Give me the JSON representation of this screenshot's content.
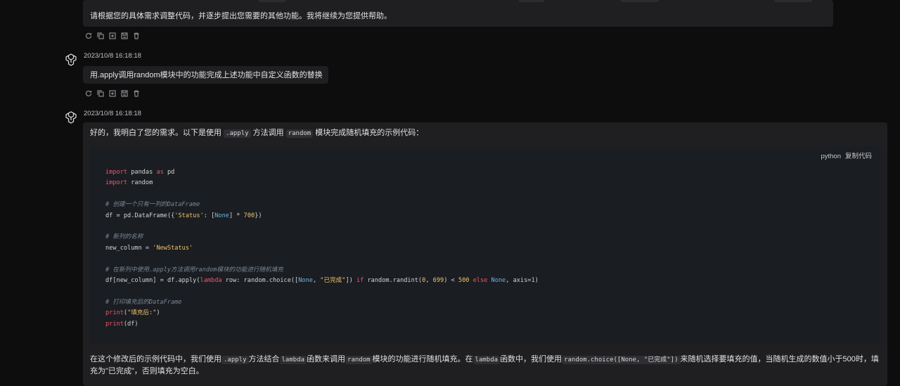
{
  "messages": {
    "prev_response_tail": "请根据您的具体需求调整代码，并逐步提出您需要的其他功能。我将继续为您提供帮助。",
    "user_timestamp": "2023/10/8 16:18:18",
    "user_text": "用.apply调用random模块中的功能完成上述功能中自定义函数的替换",
    "ai_timestamp": "2023/10/8 16:18:18",
    "ai_intro": {
      "p1": "好的，我明白了您的需求。以下是使用",
      "c1": ".apply",
      "p2": "方法调用",
      "c2": "random",
      "p3": "模块完成随机填充的示例代码："
    },
    "code_lang": "python",
    "copy_label": "复制代码",
    "code_lines": {
      "l1_a": "import",
      "l1_b": " pandas ",
      "l1_c": "as",
      "l1_d": " pd",
      "l2_a": "import",
      "l2_b": " random",
      "l4": "# 创建一个只有一列的DataFrame",
      "l5_a": "df = pd.DataFrame({",
      "l5_b": "'Status'",
      "l5_c": ": [",
      "l5_d": "None",
      "l5_e": "] * ",
      "l5_f": "700",
      "l5_g": "})",
      "l7": "# 新列的名称",
      "l8_a": "new_column = ",
      "l8_b": "'NewStatus'",
      "l10": "# 在新列中使用.apply方法调用random模块的功能进行随机填充",
      "l11_a": "df[new_column] = df.apply(",
      "l11_b": "lambda",
      "l11_c": " row: random.choice([",
      "l11_d": "None",
      "l11_e": ", ",
      "l11_f": "\"已完成\"",
      "l11_g": "]) ",
      "l11_h": "if",
      "l11_i": " random.randint(",
      "l11_j": "0",
      "l11_k": ", ",
      "l11_l": "699",
      "l11_m": ") < ",
      "l11_n": "500",
      "l11_o": " ",
      "l11_p": "else",
      "l11_q": " ",
      "l11_r": "None",
      "l11_s": ", axis=",
      "l11_t": "1",
      "l11_u": ")",
      "l13": "# 打印填充后的DataFrame",
      "l14_a": "print",
      "l14_b": "(",
      "l14_c": "\"填充后:\"",
      "l14_d": ")",
      "l15_a": "print",
      "l15_b": "(df)"
    },
    "ai_outro": {
      "p1": "在这个修改后的示例代码中，我们使用",
      "c1": ".apply",
      "p2": "方法结合",
      "c2": "lambda",
      "p3": "函数来调用",
      "c3": "random",
      "p4": "模块的功能进行随机填充。在",
      "c4": "lambda",
      "p5": "函数中，我们使用",
      "c5": "random.choice([None, \"已完成\"])",
      "p6": "来随机选择要填充的值，当随机生成的数值小于500时，填充为\"已完成\"，否则填充为空白。"
    }
  },
  "icons": [
    "refresh-icon",
    "copy-icon",
    "export-icon",
    "save-icon",
    "delete-icon",
    "chatgpt-logo-icon"
  ]
}
